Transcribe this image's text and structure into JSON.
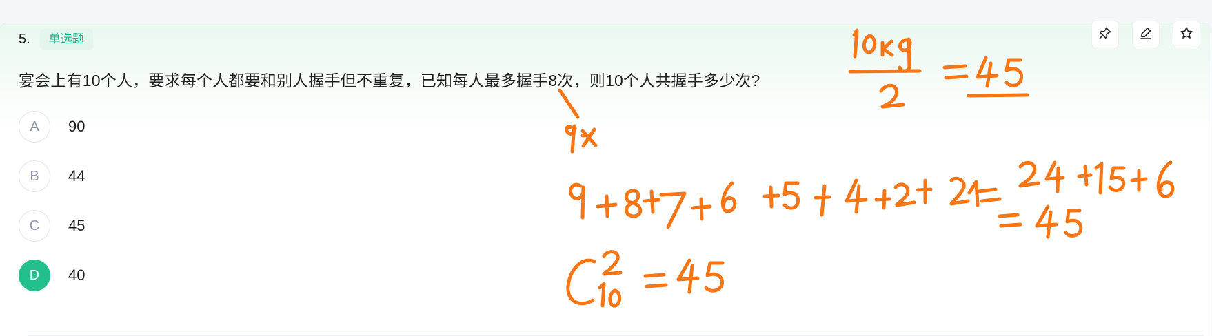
{
  "question": {
    "number": "5.",
    "type_label": "单选题",
    "text": "宴会上有10个人，要求每个人都要和别人握手但不重复，已知每人最多握手8次，则10个人共握手多少次?"
  },
  "toolbar": {
    "icons": [
      "pin-icon",
      "eraser-pen-icon",
      "star-icon"
    ]
  },
  "options": [
    {
      "letter": "A",
      "text": "90",
      "selected": false
    },
    {
      "letter": "B",
      "text": "44",
      "selected": false
    },
    {
      "letter": "C",
      "text": "45",
      "selected": false
    },
    {
      "letter": "D",
      "text": "40",
      "selected": true
    }
  ],
  "colors": {
    "accent": "#23c08e",
    "ink": "#f47617",
    "tag_bg": "#e3f5ed"
  }
}
